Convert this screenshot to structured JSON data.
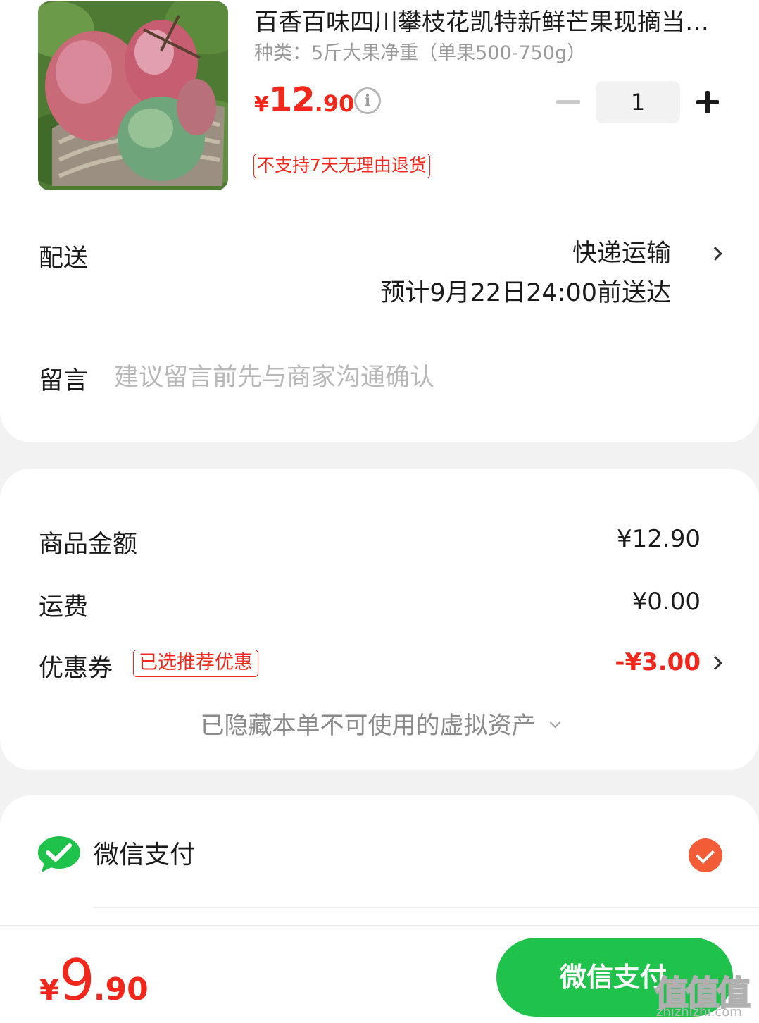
{
  "product": {
    "image_icon": "mango-photo",
    "title": "百香百味四川攀枝花凯特新鲜芒果现摘当季水果",
    "spec": "种类：5斤大果净重（单果500-750g）",
    "price_currency": "¥",
    "price_int": "12",
    "price_dec": ".90",
    "info_glyph": "i",
    "quantity": "1",
    "return_policy_tag": "不支持7天无理由退货"
  },
  "delivery": {
    "label": "配送",
    "method": "快递运输",
    "eta": "预计9月22日24:00前送达"
  },
  "note": {
    "label": "留言",
    "placeholder": "建议留言前先与商家沟通确认"
  },
  "summary": {
    "goods_label": "商品金额",
    "goods_value": "¥12.90",
    "shipping_label": "运费",
    "shipping_value": "¥0.00",
    "coupon_label": "优惠券",
    "coupon_tag": "已选推荐优惠",
    "coupon_value": "-¥3.00",
    "hidden_assets": "已隐藏本单不可使用的虚拟资产"
  },
  "payment": {
    "method_icon": "wechat-icon",
    "method_label": "微信支付",
    "selected": true
  },
  "bottom": {
    "total_currency": "¥",
    "total_int": "9",
    "total_dec": ".90",
    "pay_button": "微信支付"
  },
  "watermark": {
    "glyphs": "值值值",
    "url": "zhizhizhi.com"
  },
  "colors": {
    "accent_red": "#f2271c",
    "wechat_green": "#1fc24a",
    "check_orange": "#f25c36"
  }
}
